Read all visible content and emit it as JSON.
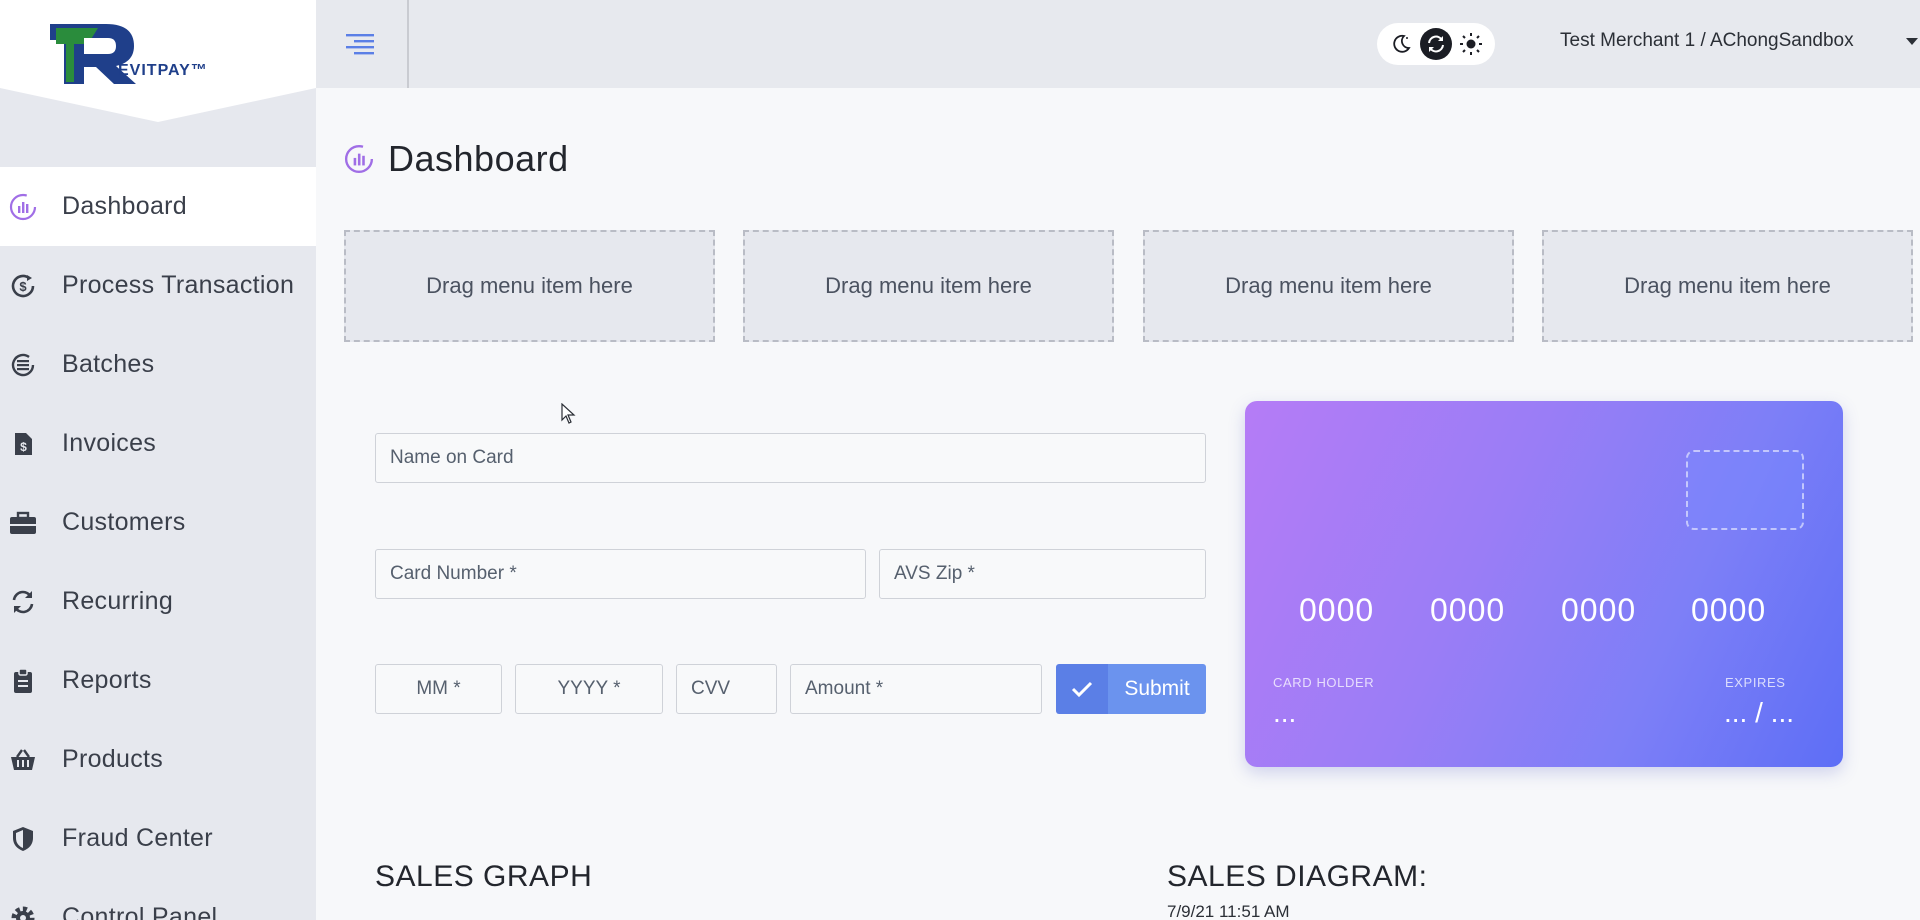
{
  "brand": {
    "name": "EVITPAY™",
    "colors": {
      "primary": "#1f3f8a",
      "accent": "#2a8c3c"
    }
  },
  "sidebar": {
    "items": [
      {
        "label": "Dashboard",
        "icon": "dashboard-icon",
        "active": true
      },
      {
        "label": "Process Transaction",
        "icon": "dollar-cycle-icon"
      },
      {
        "label": "Batches",
        "icon": "list-icon"
      },
      {
        "label": "Invoices",
        "icon": "invoice-icon"
      },
      {
        "label": "Customers",
        "icon": "briefcase-icon"
      },
      {
        "label": "Recurring",
        "icon": "refresh-icon"
      },
      {
        "label": "Reports",
        "icon": "clipboard-icon"
      },
      {
        "label": "Products",
        "icon": "basket-icon"
      },
      {
        "label": "Fraud Center",
        "icon": "shield-icon"
      },
      {
        "label": "Control Panel",
        "icon": "gear-icon"
      }
    ]
  },
  "header": {
    "merchant": "Test Merchant 1  / AChongSandbox",
    "theme_modes": [
      "dark",
      "auto",
      "light"
    ],
    "theme_active": "auto"
  },
  "page": {
    "title": "Dashboard"
  },
  "dropzones": [
    "Drag menu item here",
    "Drag menu item here",
    "Drag menu item here",
    "Drag menu item here"
  ],
  "form": {
    "name_on_card": "Name on Card",
    "card_number": "Card Number *",
    "avs_zip": "AVS Zip *",
    "mm": "MM *",
    "yyyy": "YYYY *",
    "cvv": "CVV",
    "amount": "Amount *",
    "submit": "Submit"
  },
  "card": {
    "groups": [
      "0000",
      "0000",
      "0000",
      "0000"
    ],
    "holder_caption": "CARD HOLDER",
    "holder_value": "...",
    "expires_caption": "EXPIRES",
    "expires_value": "... / ..."
  },
  "sections": {
    "sales_graph": "SALES GRAPH",
    "sales_diagram": "SALES DIAGRAM:",
    "diagram_date": "7/9/21 11:51 AM"
  }
}
